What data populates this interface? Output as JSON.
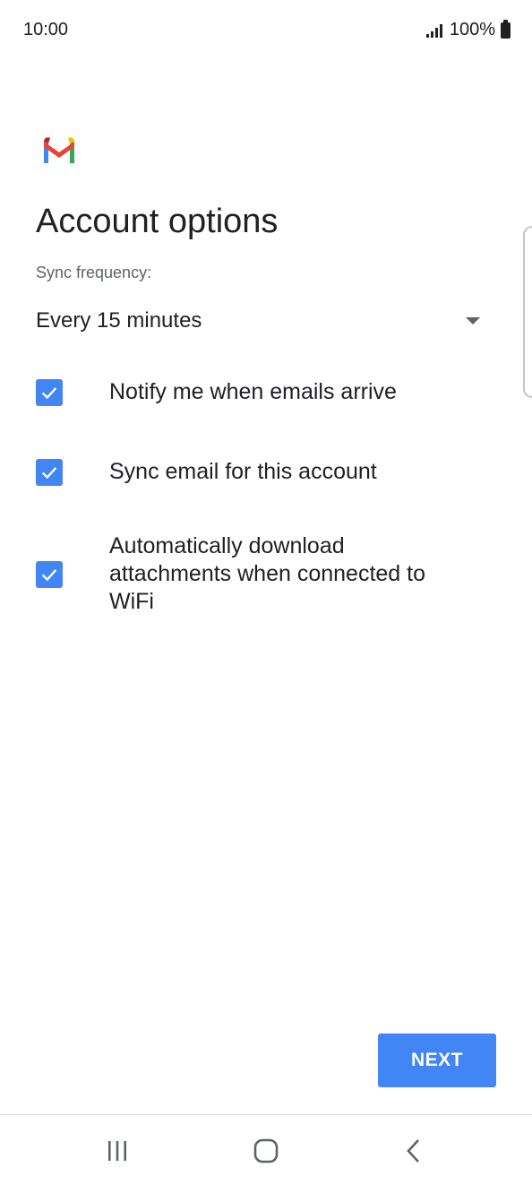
{
  "status_bar": {
    "time": "10:00",
    "battery": "100%"
  },
  "app": {
    "logo_icon": "gmail-logo-icon"
  },
  "title": "Account options",
  "sync": {
    "label": "Sync frequency:",
    "selected": "Every 15 minutes"
  },
  "options": [
    {
      "label": "Notify me when emails arrive",
      "checked": true
    },
    {
      "label": "Sync email for this account",
      "checked": true
    },
    {
      "label": "Automatically download attachments when connected to WiFi",
      "checked": true
    }
  ],
  "next_label": "NEXT",
  "colors": {
    "accent": "#4285f4",
    "text": "#202124",
    "secondary_text": "#5f6368"
  },
  "nav_icons": [
    "recent-apps-icon",
    "home-icon",
    "back-icon"
  ]
}
